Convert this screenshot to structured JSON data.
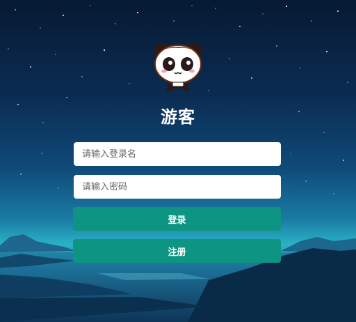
{
  "header": {
    "title": "游客"
  },
  "form": {
    "username_placeholder": "请输入登录名",
    "password_placeholder": "请输入密码",
    "login_label": "登录",
    "register_label": "注册"
  },
  "icons": {
    "avatar": "panda-avatar-icon"
  },
  "colors": {
    "button": "#0d9483",
    "input_bg": "#ffffff",
    "title": "#ffffff"
  }
}
